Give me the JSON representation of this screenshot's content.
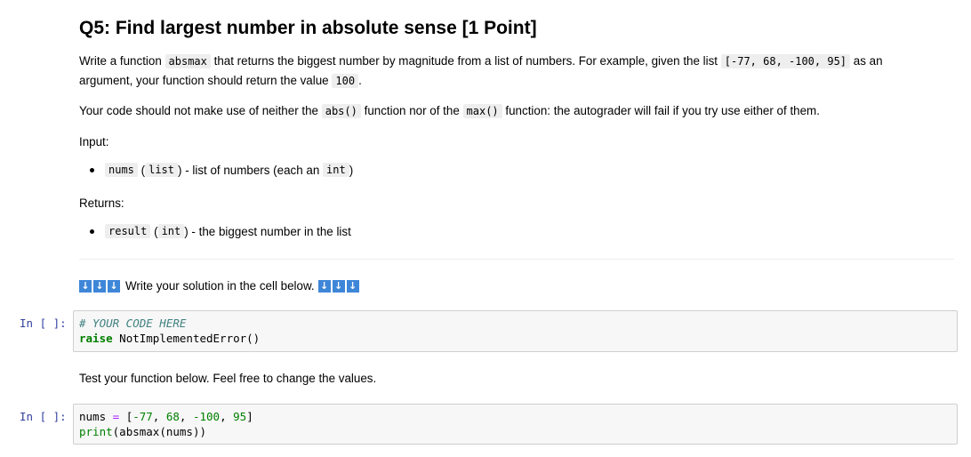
{
  "question": {
    "title": "Q5: Find largest number in absolute sense [1 Point]",
    "p1_a": "Write a function",
    "p1_code1": "absmax",
    "p1_b": "that returns the biggest number by magnitude from a list of numbers. For example, given the list",
    "p1_code2": "[-77, 68, -100, 95]",
    "p1_c": "as an",
    "p1_d": "argument, your function should return the value",
    "p1_code3": "100",
    "p1_e": ".",
    "p2_a": "Your code should not make use of neither the",
    "p2_code1": "abs()",
    "p2_b": "function nor of the",
    "p2_code2": "max()",
    "p2_c": "function: the autograder will fail if you try use either of them.",
    "input_label": "Input:",
    "input_item": {
      "code": "nums",
      "open": "(",
      "type": "list",
      "close": ") - list of numbers (each an",
      "type2": "int",
      "end": ")"
    },
    "returns_label": "Returns:",
    "returns_item": {
      "code": "result",
      "open": "(",
      "type": "int",
      "close": ") - the biggest number in the list"
    }
  },
  "instruction": {
    "arrow_glyph": "↓",
    "text": "Write your solution in the cell below."
  },
  "cell1": {
    "prompt": "In [ ]:",
    "line1": "# YOUR CODE HERE",
    "kw": "raise",
    "rest": " NotImplementedError()"
  },
  "test_text": "Test your function below. Feel free to change the values.",
  "cell2": {
    "prompt": "In [ ]:",
    "var": "nums",
    "eq": " = ",
    "list_open": "[",
    "n1": "-77",
    "n2": "68",
    "n3": "-100",
    "n4": "95",
    "list_close": "]",
    "fn": "print",
    "call": "(absmax(nums))"
  },
  "colors": {
    "arrow_bg": "#3e86d8",
    "prompt": "#303f9f",
    "cell_bg": "#f7f7f7",
    "keyword": "#008000",
    "comment": "#408080"
  }
}
